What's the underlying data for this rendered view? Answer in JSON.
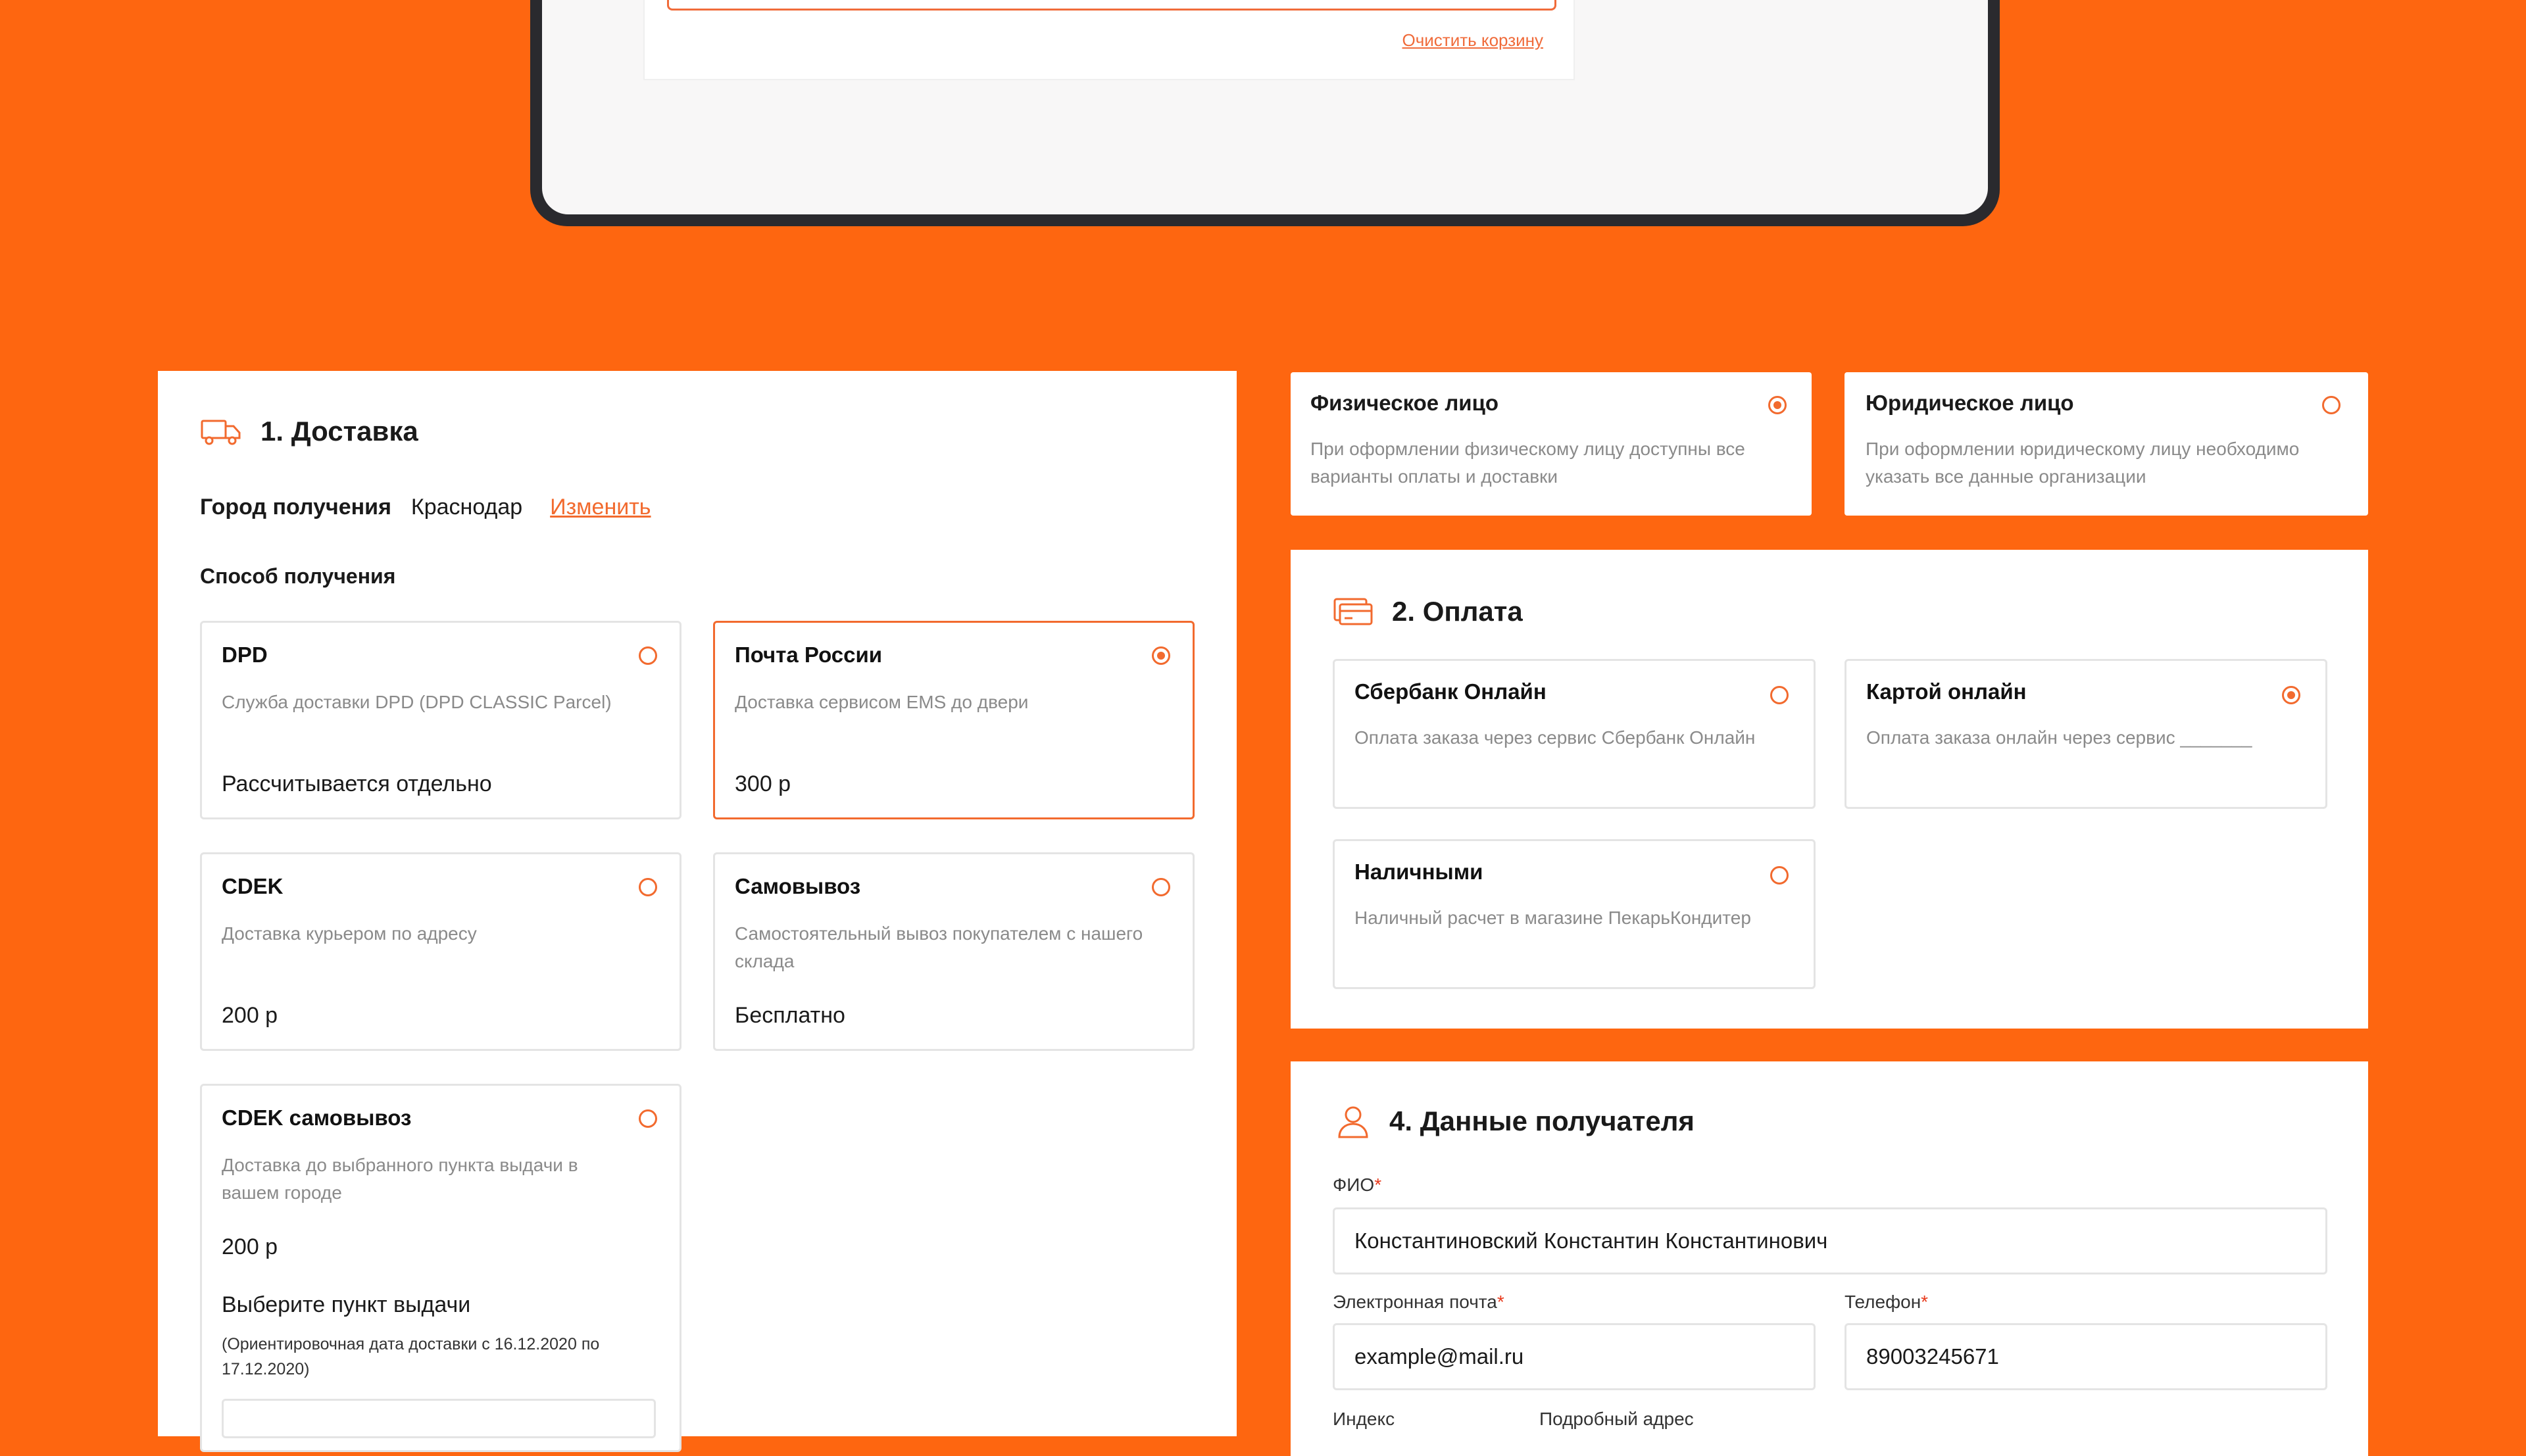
{
  "cart": {
    "clear_label": "Очистить корзину"
  },
  "delivery": {
    "title": "1. Доставка",
    "city_label": "Город получения",
    "city_value": "Краснодар",
    "city_change": "Изменить",
    "method_label": "Способ получения",
    "options": [
      {
        "title": "DPD",
        "desc": "Служба доставки DPD (DPD CLASSIC Parcel)",
        "price": "Рассчитывается отдельно",
        "selected": false
      },
      {
        "title": "Почта России",
        "desc": "Доставка сервисом EMS до двери",
        "price": "300 р",
        "selected": true
      },
      {
        "title": "CDEK",
        "desc": "Доставка курьером по адресу",
        "price": "200 р",
        "selected": false
      },
      {
        "title": "Самовывоз",
        "desc": "Самостоятельный вывоз покупателем с нашего склада",
        "price": "Бесплатно",
        "selected": false
      },
      {
        "title": "CDEK самовывоз",
        "desc": "Доставка до выбранного пункта выдачи в вашем городе",
        "price": "200 р",
        "selected": false
      }
    ],
    "pickup_label": "Выберите пункт выдачи",
    "pickup_note": "(Ориентировочная дата доставки с 16.12.2020 по 17.12.2020)"
  },
  "customer_type": [
    {
      "title": "Физическое лицо",
      "desc": "При оформлении физическому лицу доступны все варианты оплаты и доставки",
      "selected": true
    },
    {
      "title": "Юридическое лицо",
      "desc": "При оформлении юридическому лицу необходимо указать все данные организации",
      "selected": false
    }
  ],
  "payment": {
    "title": "2. Оплата",
    "options": [
      {
        "title": "Сбербанк Онлайн",
        "desc": "Оплата заказа через сервис Сбербанк Онлайн",
        "selected": false
      },
      {
        "title": "Картой онлайн",
        "desc": "Оплата заказа онлайн через сервис _______",
        "selected": true
      },
      {
        "title": "Наличными",
        "desc": "Наличный расчет в магазине ПекарьКондитер",
        "selected": false
      }
    ]
  },
  "recipient": {
    "title": "4. Данные получателя",
    "fio_label": "ФИО",
    "fio_value": "Константиновский Константин Константинович",
    "email_label": "Электронная почта",
    "email_value": "example@mail.ru",
    "phone_label": "Телефон",
    "phone_value": "89003245671",
    "index_label": "Индекс",
    "address_label": "Подробный адрес",
    "required_mark": "*"
  },
  "colors": {
    "background": "#FE6610",
    "accent": "#F26A2E",
    "required": "#E8391B"
  }
}
